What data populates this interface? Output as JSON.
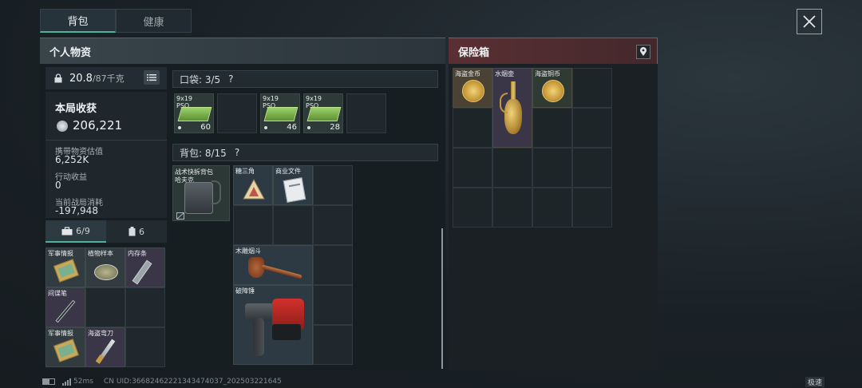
{
  "tabs": [
    {
      "label": "背包",
      "active": true
    },
    {
      "label": "健康",
      "active": false
    }
  ],
  "sections": {
    "personal_title": "个人物资",
    "safe_title": "保险箱"
  },
  "capacity": {
    "current": "20.8",
    "max_unit": "/87千克"
  },
  "session": {
    "title": "本局收获",
    "total": "206,221",
    "carry_label": "携带物资估值",
    "carry_value": "6,252K",
    "action_label": "行动收益",
    "action_value": "0",
    "cost_label": "当前战局消耗",
    "cost_value": "-197,948"
  },
  "sub_tabs": [
    {
      "label": "6/9",
      "icon": "briefcase-icon",
      "active": true
    },
    {
      "label": "6",
      "icon": "canister-icon",
      "active": false
    }
  ],
  "left_items": [
    {
      "label": "军事情报"
    },
    {
      "label": "植物样本"
    },
    {
      "label": "内存条"
    },
    {
      "label": "间谍笔"
    },
    {
      "label": "军事情报"
    },
    {
      "label": "海盗弯刀"
    }
  ],
  "pocket": {
    "label": "口袋: 3/5",
    "help": "?",
    "items": [
      {
        "label": "9x19\nPSO",
        "qty": "60"
      },
      {
        "label": "9x19\nPSO",
        "qty": "46"
      },
      {
        "label": "9x19\nPSO",
        "qty": "28"
      }
    ]
  },
  "backpack": {
    "label": "背包: 8/15",
    "help": "?",
    "bag_name": "战术快拆背包",
    "bag_sub": "哈夫克",
    "items": [
      {
        "label": "糖三角"
      },
      {
        "label": "商业文件"
      },
      {
        "label": "木雕烟斗"
      },
      {
        "label": "破障锤"
      }
    ]
  },
  "safe_items": [
    {
      "label": "海盗金币"
    },
    {
      "label": "水烟壶"
    },
    {
      "label": "海盗铜币"
    }
  ],
  "footer": {
    "ping": "52ms",
    "uid": "CN UID:36682462221343474037_202503221645",
    "mode": "极速"
  },
  "colors": {
    "accent": "#4db29a",
    "safe_accent": "#b0474f",
    "ammo_green": "#7fbf3f"
  }
}
